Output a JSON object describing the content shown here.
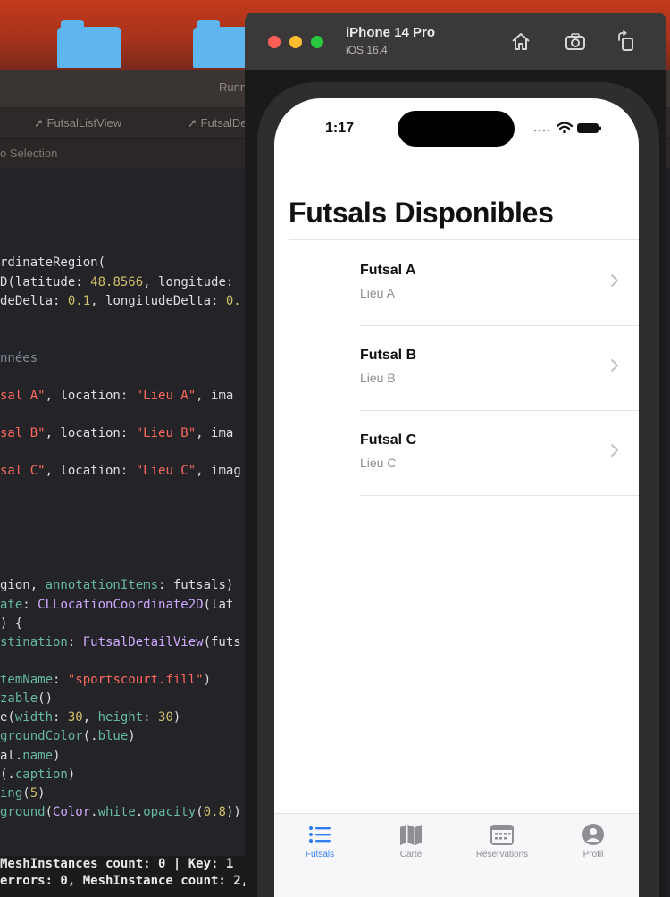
{
  "xcode": {
    "running_status": "Running rimfoot",
    "tabs": [
      "FutsalListView",
      "FutsalDet"
    ],
    "breadcrumb": "o Selection",
    "code_lines": [
      {
        "parts": [
          {
            "t": "rdinateRegion(",
            "c": ""
          }
        ]
      },
      {
        "parts": [
          {
            "t": "D(latitude: ",
            "c": ""
          },
          {
            "t": "48.8566",
            "c": "num"
          },
          {
            "t": ", longitude:",
            "c": ""
          }
        ]
      },
      {
        "parts": [
          {
            "t": "deDelta: ",
            "c": ""
          },
          {
            "t": "0.1",
            "c": "num"
          },
          {
            "t": ", longitudeDelta: ",
            "c": ""
          },
          {
            "t": "0.",
            "c": "num"
          }
        ]
      },
      {
        "parts": [
          {
            "t": "nnées",
            "c": "cm"
          }
        ]
      },
      {
        "parts": [
          {
            "t": "sal A\"",
            "c": "str"
          },
          {
            "t": ", location: ",
            "c": ""
          },
          {
            "t": "\"Lieu A\"",
            "c": "str"
          },
          {
            "t": ", ima",
            "c": ""
          }
        ]
      },
      {
        "parts": [
          {
            "t": "sal B\"",
            "c": "str"
          },
          {
            "t": ", location: ",
            "c": ""
          },
          {
            "t": "\"Lieu B\"",
            "c": "str"
          },
          {
            "t": ", ima",
            "c": ""
          }
        ]
      },
      {
        "parts": [
          {
            "t": "sal C\"",
            "c": "str"
          },
          {
            "t": ", location: ",
            "c": ""
          },
          {
            "t": "\"Lieu C\"",
            "c": "str"
          },
          {
            "t": ", imag",
            "c": ""
          }
        ]
      },
      {
        "parts": [
          {
            "t": "gion, ",
            "c": ""
          },
          {
            "t": "annotationItems",
            "c": "fn"
          },
          {
            "t": ": futsals)",
            "c": ""
          }
        ]
      },
      {
        "parts": [
          {
            "t": "ate",
            "c": "fn"
          },
          {
            "t": ": ",
            "c": ""
          },
          {
            "t": "CLLocationCoordinate2D",
            "c": "ty"
          },
          {
            "t": "(lat",
            "c": ""
          }
        ]
      },
      {
        "parts": [
          {
            "t": ") {",
            "c": ""
          }
        ]
      },
      {
        "parts": [
          {
            "t": "stination",
            "c": "fn"
          },
          {
            "t": ": ",
            "c": ""
          },
          {
            "t": "FutsalDetailView",
            "c": "ty"
          },
          {
            "t": "(futs",
            "c": ""
          }
        ]
      },
      {
        "parts": [
          {
            "t": "temName",
            "c": "fn"
          },
          {
            "t": ": ",
            "c": ""
          },
          {
            "t": "\"sportscourt.fill\"",
            "c": "str"
          },
          {
            "t": ")",
            "c": ""
          }
        ]
      },
      {
        "parts": [
          {
            "t": "zable",
            "c": "fn"
          },
          {
            "t": "()",
            "c": ""
          }
        ]
      },
      {
        "parts": [
          {
            "t": "e(",
            "c": ""
          },
          {
            "t": "width",
            "c": "fn"
          },
          {
            "t": ": ",
            "c": ""
          },
          {
            "t": "30",
            "c": "num"
          },
          {
            "t": ", ",
            "c": ""
          },
          {
            "t": "height",
            "c": "fn"
          },
          {
            "t": ": ",
            "c": ""
          },
          {
            "t": "30",
            "c": "num"
          },
          {
            "t": ")",
            "c": ""
          }
        ]
      },
      {
        "parts": [
          {
            "t": "groundColor",
            "c": "fn"
          },
          {
            "t": "(.",
            "c": ""
          },
          {
            "t": "blue",
            "c": "fn"
          },
          {
            "t": ")",
            "c": ""
          }
        ]
      },
      {
        "parts": [
          {
            "t": "al.",
            "c": ""
          },
          {
            "t": "name",
            "c": "fn"
          },
          {
            "t": ")",
            "c": ""
          }
        ]
      },
      {
        "parts": [
          {
            "t": "(.",
            "c": ""
          },
          {
            "t": "caption",
            "c": "fn"
          },
          {
            "t": ")",
            "c": ""
          }
        ]
      },
      {
        "parts": [
          {
            "t": "ing",
            "c": "fn"
          },
          {
            "t": "(",
            "c": ""
          },
          {
            "t": "5",
            "c": "num"
          },
          {
            "t": ")",
            "c": ""
          }
        ]
      },
      {
        "parts": [
          {
            "t": "ground",
            "c": "fn"
          },
          {
            "t": "(",
            "c": ""
          },
          {
            "t": "Color",
            "c": "ty"
          },
          {
            "t": ".",
            "c": ""
          },
          {
            "t": "white",
            "c": "fn"
          },
          {
            "t": ".",
            "c": ""
          },
          {
            "t": "opacity",
            "c": "fn"
          },
          {
            "t": "(",
            "c": ""
          },
          {
            "t": "0.8",
            "c": "num"
          },
          {
            "t": "))",
            "c": ""
          }
        ]
      }
    ],
    "console_lines": [
      "MeshInstances count: 0 | Key: 1",
      "errors: 0, MeshInstance count: 2,"
    ]
  },
  "simulator": {
    "device_name": "iPhone 14 Pro",
    "os_version": "iOS 16.4",
    "toolbar_icons": [
      "home-icon",
      "screenshot-icon",
      "rotate-icon"
    ]
  },
  "phone": {
    "status_time": "1:17",
    "nav_title": "Futsals Disponibles",
    "futsals": [
      {
        "name": "Futsal A",
        "location": "Lieu A"
      },
      {
        "name": "Futsal B",
        "location": "Lieu B"
      },
      {
        "name": "Futsal C",
        "location": "Lieu C"
      }
    ],
    "tabs": [
      {
        "label": "Futsals",
        "icon": "list-icon",
        "active": true
      },
      {
        "label": "Carte",
        "icon": "map-icon",
        "active": false
      },
      {
        "label": "Réservations",
        "icon": "calendar-icon",
        "active": false
      },
      {
        "label": "Profil",
        "icon": "person-icon",
        "active": false
      }
    ],
    "accent_color": "#2f7df6"
  }
}
